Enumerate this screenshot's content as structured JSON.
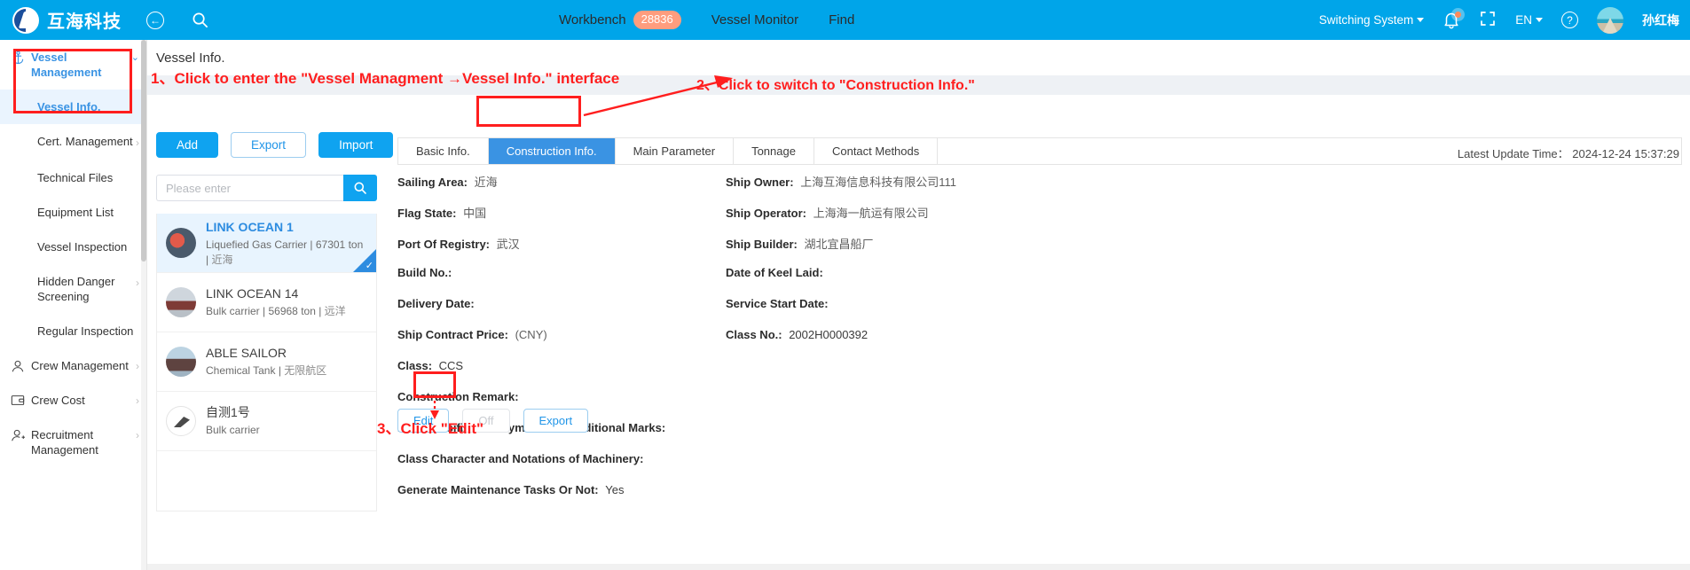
{
  "header": {
    "brand": "互海科技",
    "back_icon": "back-arrow-icon",
    "search_icon": "search-icon",
    "nav": [
      {
        "label": "Workbench",
        "badge": "28836"
      },
      {
        "label": "Vessel Monitor",
        "badge": ""
      },
      {
        "label": "Find",
        "badge": ""
      }
    ],
    "switching_system": "Switching System",
    "language": "EN",
    "user_name": "孙红梅",
    "accent_color": "#00A5E9",
    "badge_color": "#FF9D7E"
  },
  "sidebar": {
    "groups": [
      {
        "label": "Vessel Management",
        "icon": "anchor-icon",
        "expanded": true,
        "items": [
          {
            "label": "Vessel Info.",
            "selected": true,
            "has_chevron": false
          },
          {
            "label": "Cert. Management",
            "selected": false,
            "has_chevron": true
          },
          {
            "label": "Technical Files",
            "selected": false,
            "has_chevron": false
          },
          {
            "label": "Equipment List",
            "selected": false,
            "has_chevron": false
          },
          {
            "label": "Vessel Inspection",
            "selected": false,
            "has_chevron": false
          },
          {
            "label": "Hidden Danger Screening",
            "selected": false,
            "has_chevron": true
          },
          {
            "label": "Regular Inspection",
            "selected": false,
            "has_chevron": false
          }
        ]
      },
      {
        "label": "Crew Management",
        "icon": "user-icon",
        "expanded": false,
        "items": []
      },
      {
        "label": "Crew Cost",
        "icon": "wallet-icon",
        "expanded": false,
        "items": []
      },
      {
        "label": "Recruitment Management",
        "icon": "user-plus-icon",
        "expanded": false,
        "items": []
      }
    ]
  },
  "main": {
    "page_title": "Vessel Info.",
    "latest_update_label": "Latest Update Time：",
    "latest_update_value": "2024-12-24 15:37:29",
    "toolbar": {
      "add": "Add",
      "export": "Export",
      "import": "Import"
    },
    "search": {
      "placeholder": "Please enter",
      "value": "",
      "icon": "search-icon"
    },
    "vessels": [
      {
        "name": "LINK OCEAN 1",
        "meta_type": "Liquefied Gas Carrier",
        "meta_tonnage": "67301 ton",
        "meta_area": "近海",
        "selected": true
      },
      {
        "name": "LINK OCEAN 14",
        "meta_type": "Bulk carrier",
        "meta_tonnage": "56968 ton",
        "meta_area": "远洋",
        "selected": false
      },
      {
        "name": "ABLE SAILOR",
        "meta_type": "Chemical Tank",
        "meta_tonnage": "",
        "meta_area": "无限航区",
        "selected": false
      },
      {
        "name": "自测1号",
        "meta_type": "Bulk carrier",
        "meta_tonnage": "",
        "meta_area": "",
        "selected": false
      }
    ],
    "tabs": [
      {
        "label": "Basic Info.",
        "active": false
      },
      {
        "label": "Construction Info.",
        "active": true
      },
      {
        "label": "Main Parameter",
        "active": false
      },
      {
        "label": "Tonnage",
        "active": false
      },
      {
        "label": "Contact Methods",
        "active": false
      }
    ],
    "form_left": [
      {
        "label": "Sailing Area:",
        "value": "近海"
      },
      {
        "label": "Flag State:",
        "value": "中国"
      },
      {
        "label": "Port Of Registry:",
        "value": "武汉"
      },
      {
        "label": "Build No.:",
        "value": ""
      },
      {
        "label": "Delivery Date:",
        "value": ""
      },
      {
        "label": "Ship Contract Price:",
        "value": "(CNY)"
      },
      {
        "label": "Class:",
        "value": "CCS"
      },
      {
        "label": "Construction Remark:",
        "value": ""
      },
      {
        "label": "Hull Classification Symbol and Additional Marks:",
        "value": ""
      },
      {
        "label": "Class Character and Notations of Machinery:",
        "value": ""
      },
      {
        "label": "Generate Maintenance Tasks Or Not:",
        "value": "Yes"
      }
    ],
    "form_right": [
      {
        "label": "Ship Owner:",
        "value": "上海互海信息科技有限公司111"
      },
      {
        "label": "Ship Operator:",
        "value": "上海海一航运有限公司"
      },
      {
        "label": "Ship Builder:",
        "value": "湖北宜昌船厂"
      },
      {
        "label": "Date of Keel Laid:",
        "value": ""
      },
      {
        "label": "Service Start Date:",
        "value": ""
      },
      {
        "label": "Class No.:",
        "value": "2002H0000392"
      }
    ],
    "actions": {
      "edit": "Edit",
      "off": "Off",
      "export": "Export"
    }
  },
  "annotations": {
    "step1": "1、Click to enter the \"Vessel Managment →Vessel Info.\" interface",
    "step2": "2、Click to switch to \"Construction Info.\"",
    "step3": "3、Click \"Edit\"",
    "color": "#FF1E1E"
  }
}
